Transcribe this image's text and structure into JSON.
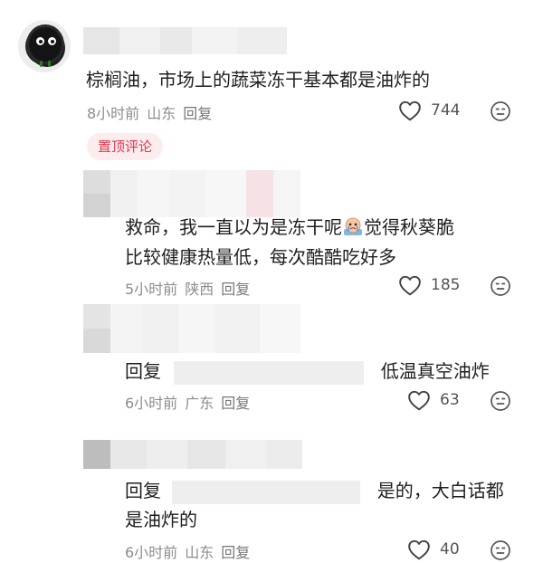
{
  "comments": [
    {
      "text": "棕榈油，市场上的蔬菜冻干基本都是油炸的",
      "time": "8小时前",
      "location": "山东",
      "reply_label": "回复",
      "likes": "744"
    },
    {
      "badge": "置顶评论",
      "text_line1_a": "救命，我一直以为是冻干呢",
      "text_line1_b": "觉得秋葵脆",
      "text_line2": "比较健康热量低，每次酷酷吃好多",
      "time": "5小时前",
      "location": "陕西",
      "reply_label": "回复",
      "likes": "185"
    },
    {
      "reply_prefix": "回复",
      "text": "低温真空油炸",
      "time": "6小时前",
      "location": "广东",
      "reply_label": "回复",
      "likes": "63"
    },
    {
      "reply_prefix": "回复",
      "text_line1": "是的，大白话都",
      "text_line2": "是油炸的",
      "time": "6小时前",
      "location": "山东",
      "reply_label": "回复",
      "likes": "40"
    }
  ],
  "icons": {
    "like": "heart-outline-icon",
    "reaction": "emoji-face-icon"
  },
  "colors": {
    "badge_text": "#e0394f",
    "badge_bg": "#fdecee",
    "meta_text": "#8c8c8c"
  }
}
